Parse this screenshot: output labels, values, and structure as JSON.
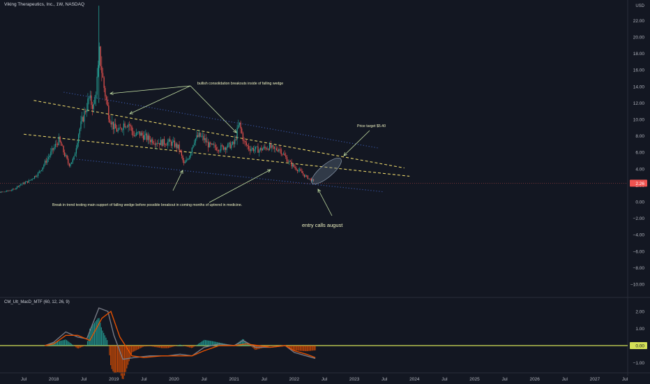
{
  "header": {
    "symbol_title": "Viking Therapeutics, Inc., 1W, NASDAQ",
    "currency": "USD"
  },
  "indicator": {
    "title": "CM_Ult_MacD_MTF (60, 12, 26, 9)"
  },
  "annotations": {
    "consolidation": "bullish consolidation breakouts inside of falling wedge",
    "price_target": "Price target  $5.40",
    "support_break": "Break in trend testing main support of falling wedge before possible breakout in coming months of uptrend in medicine.",
    "entry": "entry calls august"
  },
  "chart_data": [
    {
      "type": "candlestick",
      "title": "Viking Therapeutics, Inc., 1W, NASDAQ",
      "ylabel": "USD",
      "ylim": [
        -11,
        24
      ],
      "yticks": [
        22,
        20,
        18,
        16,
        14,
        12,
        10,
        8,
        6,
        4,
        2,
        0,
        -2,
        -4,
        -6,
        -8,
        -10
      ],
      "ytick_labels": [
        "22.00",
        "20.00",
        "18.00",
        "16.00",
        "14.00",
        "12.00",
        "10.00",
        "8.00",
        "6.00",
        "4.00",
        "2.00",
        "0.00",
        "−2.00",
        "−4.00",
        "−6.00",
        "−8.00",
        "−10.00"
      ],
      "xtick_labels": [
        "Jul",
        "2018",
        "Jul",
        "2019",
        "Jul",
        "2020",
        "Jul",
        "2021",
        "Jul",
        "2022",
        "Jul",
        "2023",
        "Jul",
        "2024",
        "Jul",
        "2025",
        "Jul",
        "2026",
        "Jul",
        "2027",
        "Jul"
      ],
      "last_price": 2.26,
      "last_price_label": "2.26",
      "up_color": "#26a69a",
      "down_color": "#ef5350",
      "close_path": [
        [
          "2016-11",
          1.3
        ],
        [
          "2017-01",
          1.1
        ],
        [
          "2017-03",
          1.2
        ],
        [
          "2017-05",
          1.5
        ],
        [
          "2017-06",
          2.0
        ],
        [
          "2017-08",
          2.5
        ],
        [
          "2017-10",
          3.5
        ],
        [
          "2017-11",
          4.5
        ],
        [
          "2017-12",
          5.5
        ],
        [
          "2018-01",
          6.5
        ],
        [
          "2018-02",
          7.5
        ],
        [
          "2018-03",
          6.0
        ],
        [
          "2018-04",
          4.5
        ],
        [
          "2018-05",
          5.2
        ],
        [
          "2018-06",
          8.5
        ],
        [
          "2018-07",
          10.5
        ],
        [
          "2018-08",
          12.5
        ],
        [
          "2018-09",
          11.5
        ],
        [
          "2018-10",
          16.5
        ],
        [
          "2018-10",
          18.5
        ],
        [
          "2018-11",
          14.0
        ],
        [
          "2018-12",
          10.5
        ],
        [
          "2019-01",
          9.0
        ],
        [
          "2019-02",
          8.5
        ],
        [
          "2019-03",
          9.5
        ],
        [
          "2019-04",
          9.5
        ],
        [
          "2019-05",
          8.0
        ],
        [
          "2019-06",
          8.3
        ],
        [
          "2019-08",
          7.6
        ],
        [
          "2019-10",
          7.2
        ],
        [
          "2019-12",
          7.2
        ],
        [
          "2020-01",
          7.0
        ],
        [
          "2020-02",
          6.5
        ],
        [
          "2020-03",
          4.5
        ],
        [
          "2020-04",
          5.5
        ],
        [
          "2020-05",
          7.5
        ],
        [
          "2020-06",
          8.0
        ],
        [
          "2020-07",
          7.6
        ],
        [
          "2020-08",
          6.8
        ],
        [
          "2020-10",
          6.5
        ],
        [
          "2020-12",
          6.8
        ],
        [
          "2021-01",
          7.0
        ],
        [
          "2021-02",
          9.5
        ],
        [
          "2021-03",
          7.2
        ],
        [
          "2021-04",
          6.5
        ],
        [
          "2021-06",
          6.3
        ],
        [
          "2021-07",
          6.5
        ],
        [
          "2021-08",
          6.7
        ],
        [
          "2021-09",
          6.3
        ],
        [
          "2021-10",
          6.5
        ],
        [
          "2021-11",
          5.6
        ],
        [
          "2021-12",
          4.8
        ],
        [
          "2022-01",
          4.2
        ],
        [
          "2022-02",
          3.8
        ],
        [
          "2022-03",
          3.2
        ],
        [
          "2022-04",
          2.8
        ],
        [
          "2022-05",
          2.4
        ],
        [
          "2022-05",
          2.26
        ]
      ],
      "spike_high": 23.8,
      "trendlines": [
        {
          "name": "upper wedge",
          "style": "dashed",
          "color": "#e6d36a",
          "from": [
            "2017-09",
            12.3
          ],
          "to": [
            "2023-11",
            4.1
          ]
        },
        {
          "name": "lower wedge",
          "style": "dashed",
          "color": "#e6d36a",
          "from": [
            "2017-07",
            8.2
          ],
          "to": [
            "2023-12",
            3.1
          ]
        },
        {
          "name": "upper channel",
          "style": "dotted",
          "color": "#3f5fb8",
          "from": [
            "2018-03",
            13.3
          ],
          "to": [
            "2023-06",
            6.5
          ]
        },
        {
          "name": "lower channel",
          "style": "dotted",
          "color": "#3f5fb8",
          "from": [
            "2018-05",
            5.2
          ],
          "to": [
            "2023-07",
            1.2
          ]
        }
      ]
    },
    {
      "type": "line",
      "title": "CM_Ult_MacD_MTF (60, 12, 26, 9)",
      "ylim": [
        -1.4,
        2.6
      ],
      "yticks": [
        2.0,
        1.0,
        0.0,
        -1.0
      ],
      "ytick_labels": [
        "2.00",
        "1.00",
        "0.00",
        "−1.00"
      ],
      "zero_line_color": "#d4e157",
      "series": [
        {
          "color": "#787b86",
          "values": [
            [
              2017.85,
              0
            ],
            [
              2018.0,
              0.2
            ],
            [
              2018.2,
              0.8
            ],
            [
              2018.4,
              0.5
            ],
            [
              2018.55,
              0.4
            ],
            [
              2018.75,
              2.2
            ],
            [
              2018.9,
              2.0
            ],
            [
              2019.0,
              0.6
            ],
            [
              2019.15,
              -0.8
            ],
            [
              2019.35,
              -0.7
            ],
            [
              2019.6,
              -0.6
            ],
            [
              2019.9,
              -0.6
            ],
            [
              2020.1,
              -0.5
            ],
            [
              2020.3,
              -0.6
            ],
            [
              2020.5,
              -0.1
            ],
            [
              2020.75,
              0.1
            ],
            [
              2021.0,
              0.0
            ],
            [
              2021.15,
              0.3
            ],
            [
              2021.35,
              -0.1
            ],
            [
              2021.6,
              -0.1
            ],
            [
              2021.85,
              0.0
            ],
            [
              2022.0,
              -0.4
            ],
            [
              2022.2,
              -0.6
            ],
            [
              2022.35,
              -0.75
            ]
          ]
        },
        {
          "color": "#e65100",
          "values": [
            [
              2017.85,
              0
            ],
            [
              2018.0,
              0.1
            ],
            [
              2018.2,
              0.6
            ],
            [
              2018.4,
              0.6
            ],
            [
              2018.6,
              0.3
            ],
            [
              2018.8,
              1.6
            ],
            [
              2018.95,
              2.0
            ],
            [
              2019.1,
              0.5
            ],
            [
              2019.3,
              -0.6
            ],
            [
              2019.5,
              -0.7
            ],
            [
              2019.8,
              -0.6
            ],
            [
              2020.1,
              -0.6
            ],
            [
              2020.3,
              -0.6
            ],
            [
              2020.5,
              -0.3
            ],
            [
              2020.75,
              0.0
            ],
            [
              2021.0,
              0.0
            ],
            [
              2021.2,
              0.1
            ],
            [
              2021.4,
              0.0
            ],
            [
              2021.6,
              -0.1
            ],
            [
              2021.85,
              0.0
            ],
            [
              2022.0,
              -0.3
            ],
            [
              2022.2,
              -0.5
            ],
            [
              2022.35,
              -0.7
            ]
          ]
        }
      ]
    }
  ]
}
